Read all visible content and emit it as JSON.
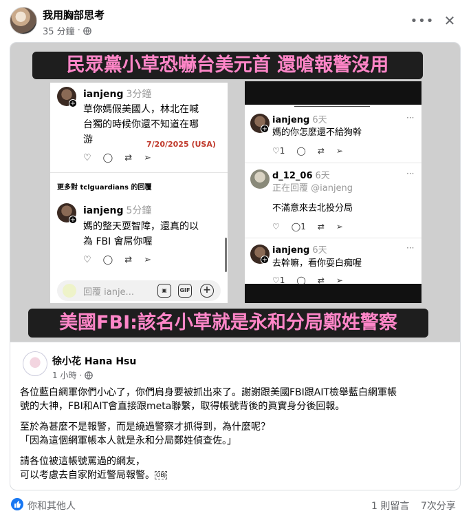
{
  "post": {
    "author": "我用胸部思考",
    "time": "35 分鐘",
    "dot": "·",
    "privacy_icon": "globe-icon",
    "more_icon": "more-icon",
    "close_icon": "close-icon"
  },
  "meme": {
    "banner_top": "民眾黨小草恐嚇台美元首 還嗆報警沒用",
    "banner_bottom": "美國FBI:該名小草就是永和分局鄭姓警察",
    "left_panel": {
      "comment1": {
        "user": "ianjeng",
        "time": "3分鐘",
        "lines": [
          "草你媽假美國人，林北在喊",
          "台獨的時候你還不知道在哪",
          "游"
        ],
        "stamp": "7/20/2025 (USA)"
      },
      "section_label": "更多對 tclguardians 的回覆",
      "comment2": {
        "user": "ianjeng",
        "time": "5分鐘",
        "lines": [
          "媽的整天耍智障，還真的以",
          "為 FBI 會屌你喔"
        ]
      },
      "reply_placeholder": "回覆 ianje...",
      "reply_gif": "GIF"
    },
    "right_panel": {
      "comment1": {
        "user": "ianjeng",
        "time": "6天",
        "text": "媽的你怎麼還不給狗幹",
        "likes": "1"
      },
      "comment2": {
        "user": "d_12_06",
        "time": "6天",
        "reply_to": "正在回覆 @ianjeng",
        "text": "不滿意來去北投分局",
        "replies": "1"
      },
      "comment3": {
        "user": "ianjeng",
        "time": "6天",
        "text": "去幹嘛，看你耍白痴喔",
        "likes": "1"
      }
    }
  },
  "nested_post": {
    "author": "徐小花 Hana Hsu",
    "time": "1 小時",
    "dot": "·",
    "paragraph1": [
      "各位藍白網軍你們小心了，你們肩身要被抓出來了。謝謝跟美國FBI跟AIT檢舉藍白網軍帳",
      "號的大神，FBI和AIT會直接跟meta聯繫，取得帳號背後的眞實身分後回報。"
    ],
    "paragraph2": [
      "至於為甚麼不是報警，而是繞過警察才抓得到，為什麼呢？",
      "「因為這個網軍帳本人就是永和分局鄭姓偵查佐。」"
    ],
    "paragraph3": [
      "請各位被這帳號罵過的網友，",
      "可以考慮去自家附近警局報警。"
    ],
    "obj_mark": "OBJ"
  },
  "footer": {
    "reactors": "你和其他人",
    "comments": "1 則留言",
    "shares": "7次分享"
  },
  "colors": {
    "banner_text": "#ff86c8",
    "banner_bg": "#1e1e1e",
    "link_blue": "#1877f2",
    "secondary_text": "#65676b"
  }
}
